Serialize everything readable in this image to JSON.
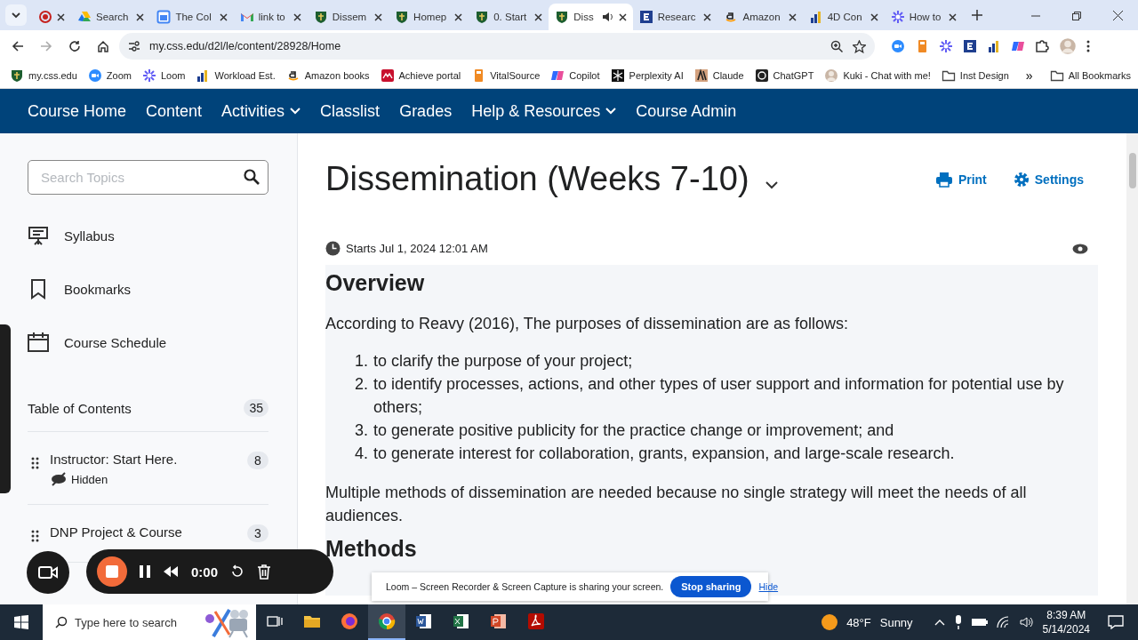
{
  "browser": {
    "tabs": [
      {
        "kind": "record",
        "selected": false,
        "audio": false
      },
      {
        "kind": "drive",
        "title": "Search",
        "selected": false,
        "audio": false
      },
      {
        "kind": "calendar",
        "title": "The Col",
        "selected": false,
        "audio": false
      },
      {
        "kind": "gmail",
        "title": "link to",
        "selected": false,
        "audio": false
      },
      {
        "kind": "shield",
        "title": "Dissem",
        "selected": false,
        "audio": false
      },
      {
        "kind": "shield",
        "title": "Homep",
        "selected": false,
        "audio": false
      },
      {
        "kind": "shield",
        "title": "0. Start",
        "selected": false,
        "audio": false
      },
      {
        "kind": "shield",
        "title": "Diss",
        "selected": true,
        "audio": true
      },
      {
        "kind": "letter",
        "title": "Researc",
        "selected": false,
        "audio": false
      },
      {
        "kind": "amazon",
        "title": "Amazon",
        "selected": false,
        "audio": false
      },
      {
        "kind": "chart",
        "title": "4D Con",
        "selected": false,
        "audio": false
      },
      {
        "kind": "loom",
        "title": "How to",
        "selected": false,
        "audio": false
      }
    ],
    "url": "my.css.edu/d2l/le/content/28928/Home",
    "bookmarks": [
      {
        "kind": "shield",
        "label": "my.css.edu"
      },
      {
        "kind": "zoom",
        "label": "Zoom"
      },
      {
        "kind": "loom",
        "label": "Loom"
      },
      {
        "kind": "chart",
        "label": "Workload Est."
      },
      {
        "kind": "amazon",
        "label": "Amazon books"
      },
      {
        "kind": "achieve",
        "label": "Achieve portal"
      },
      {
        "kind": "book",
        "label": "VitalSource"
      },
      {
        "kind": "copilot",
        "label": "Copilot"
      },
      {
        "kind": "perplexity",
        "label": "Perplexity AI"
      },
      {
        "kind": "claude",
        "label": "Claude"
      },
      {
        "kind": "chatgpt",
        "label": "ChatGPT"
      },
      {
        "kind": "avatar",
        "label": "Kuki - Chat with me!"
      },
      {
        "kind": "folder",
        "label": "Inst Design"
      }
    ],
    "more": "»",
    "all_bookmarks": "All Bookmarks"
  },
  "course_nav": [
    {
      "label": "Course Home",
      "dropdown": false
    },
    {
      "label": "Content",
      "dropdown": false
    },
    {
      "label": "Activities",
      "dropdown": true
    },
    {
      "label": "Classlist",
      "dropdown": false
    },
    {
      "label": "Grades",
      "dropdown": false
    },
    {
      "label": "Help & Resources",
      "dropdown": true
    },
    {
      "label": "Course Admin",
      "dropdown": false
    }
  ],
  "sidebar": {
    "search": {
      "placeholder": "Search Topics"
    },
    "links": [
      {
        "kind": "easel",
        "label": "Syllabus"
      },
      {
        "kind": "bookmark",
        "label": "Bookmarks"
      },
      {
        "kind": "calendar",
        "label": "Course Schedule"
      }
    ],
    "toc": {
      "label": "Table of Contents",
      "count": "35"
    },
    "modules": [
      {
        "title": "Instructor: Start Here.",
        "count": "8",
        "hidden": true,
        "hidden_label": "Hidden"
      },
      {
        "title": "DNP Project & Course",
        "count": "3",
        "hidden": false
      }
    ]
  },
  "content": {
    "title": "Dissemination (Weeks 7-10)",
    "print": "Print",
    "settings": "Settings",
    "starts": "Starts Jul 1, 2024 12:01 AM",
    "overview_heading": "Overview",
    "intro": "According to Reavy (2016), The purposes of dissemination are as follows:",
    "purposes": [
      {
        "number": "1.",
        "text": "to clarify the purpose of your project;"
      },
      {
        "number": "2.",
        "text": "to identify processes, actions, and other types of user support and information for potential use by others;"
      },
      {
        "number": "3.",
        "text": "to generate positive publicity for the practice change or improvement; and"
      },
      {
        "number": "4.",
        "text": "to generate interest for collaboration, grants, expansion, and large-scale research."
      }
    ],
    "closing": "Multiple methods of dissemination are needed because no single strategy will meet the needs of all audiences.",
    "methods_heading": "Methods"
  },
  "recorder": {
    "timer": "0:00"
  },
  "sharing_bar": {
    "message": "Loom – Screen Recorder & Screen Capture is sharing your screen.",
    "stop": "Stop sharing",
    "hide": "Hide"
  },
  "taskbar": {
    "search_placeholder": "Type here to search",
    "apps": [
      {
        "kind": "explorer",
        "active": false
      },
      {
        "kind": "firefox",
        "active": false
      },
      {
        "kind": "chrome",
        "active": true
      },
      {
        "kind": "word",
        "active": false
      },
      {
        "kind": "excel",
        "active": false
      },
      {
        "kind": "powerpoint",
        "active": false
      },
      {
        "kind": "acrobat",
        "active": false
      }
    ],
    "temperature": "48°F",
    "weather": "Sunny",
    "time": "8:39 AM",
    "date": "5/14/2024"
  }
}
